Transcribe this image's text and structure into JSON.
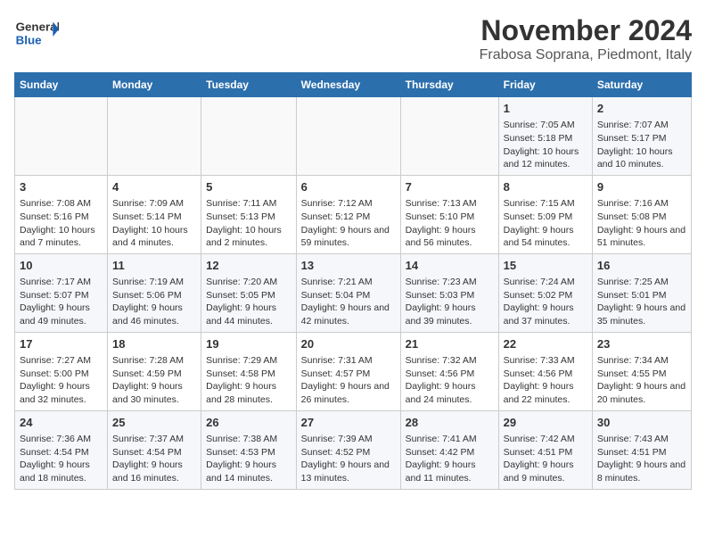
{
  "header": {
    "logo_general": "General",
    "logo_blue": "Blue",
    "month_year": "November 2024",
    "location": "Frabosa Soprana, Piedmont, Italy"
  },
  "calendar": {
    "day_headers": [
      "Sunday",
      "Monday",
      "Tuesday",
      "Wednesday",
      "Thursday",
      "Friday",
      "Saturday"
    ],
    "weeks": [
      [
        {
          "day": "",
          "info": ""
        },
        {
          "day": "",
          "info": ""
        },
        {
          "day": "",
          "info": ""
        },
        {
          "day": "",
          "info": ""
        },
        {
          "day": "",
          "info": ""
        },
        {
          "day": "1",
          "info": "Sunrise: 7:05 AM\nSunset: 5:18 PM\nDaylight: 10 hours and 12 minutes."
        },
        {
          "day": "2",
          "info": "Sunrise: 7:07 AM\nSunset: 5:17 PM\nDaylight: 10 hours and 10 minutes."
        }
      ],
      [
        {
          "day": "3",
          "info": "Sunrise: 7:08 AM\nSunset: 5:16 PM\nDaylight: 10 hours and 7 minutes."
        },
        {
          "day": "4",
          "info": "Sunrise: 7:09 AM\nSunset: 5:14 PM\nDaylight: 10 hours and 4 minutes."
        },
        {
          "day": "5",
          "info": "Sunrise: 7:11 AM\nSunset: 5:13 PM\nDaylight: 10 hours and 2 minutes."
        },
        {
          "day": "6",
          "info": "Sunrise: 7:12 AM\nSunset: 5:12 PM\nDaylight: 9 hours and 59 minutes."
        },
        {
          "day": "7",
          "info": "Sunrise: 7:13 AM\nSunset: 5:10 PM\nDaylight: 9 hours and 56 minutes."
        },
        {
          "day": "8",
          "info": "Sunrise: 7:15 AM\nSunset: 5:09 PM\nDaylight: 9 hours and 54 minutes."
        },
        {
          "day": "9",
          "info": "Sunrise: 7:16 AM\nSunset: 5:08 PM\nDaylight: 9 hours and 51 minutes."
        }
      ],
      [
        {
          "day": "10",
          "info": "Sunrise: 7:17 AM\nSunset: 5:07 PM\nDaylight: 9 hours and 49 minutes."
        },
        {
          "day": "11",
          "info": "Sunrise: 7:19 AM\nSunset: 5:06 PM\nDaylight: 9 hours and 46 minutes."
        },
        {
          "day": "12",
          "info": "Sunrise: 7:20 AM\nSunset: 5:05 PM\nDaylight: 9 hours and 44 minutes."
        },
        {
          "day": "13",
          "info": "Sunrise: 7:21 AM\nSunset: 5:04 PM\nDaylight: 9 hours and 42 minutes."
        },
        {
          "day": "14",
          "info": "Sunrise: 7:23 AM\nSunset: 5:03 PM\nDaylight: 9 hours and 39 minutes."
        },
        {
          "day": "15",
          "info": "Sunrise: 7:24 AM\nSunset: 5:02 PM\nDaylight: 9 hours and 37 minutes."
        },
        {
          "day": "16",
          "info": "Sunrise: 7:25 AM\nSunset: 5:01 PM\nDaylight: 9 hours and 35 minutes."
        }
      ],
      [
        {
          "day": "17",
          "info": "Sunrise: 7:27 AM\nSunset: 5:00 PM\nDaylight: 9 hours and 32 minutes."
        },
        {
          "day": "18",
          "info": "Sunrise: 7:28 AM\nSunset: 4:59 PM\nDaylight: 9 hours and 30 minutes."
        },
        {
          "day": "19",
          "info": "Sunrise: 7:29 AM\nSunset: 4:58 PM\nDaylight: 9 hours and 28 minutes."
        },
        {
          "day": "20",
          "info": "Sunrise: 7:31 AM\nSunset: 4:57 PM\nDaylight: 9 hours and 26 minutes."
        },
        {
          "day": "21",
          "info": "Sunrise: 7:32 AM\nSunset: 4:56 PM\nDaylight: 9 hours and 24 minutes."
        },
        {
          "day": "22",
          "info": "Sunrise: 7:33 AM\nSunset: 4:56 PM\nDaylight: 9 hours and 22 minutes."
        },
        {
          "day": "23",
          "info": "Sunrise: 7:34 AM\nSunset: 4:55 PM\nDaylight: 9 hours and 20 minutes."
        }
      ],
      [
        {
          "day": "24",
          "info": "Sunrise: 7:36 AM\nSunset: 4:54 PM\nDaylight: 9 hours and 18 minutes."
        },
        {
          "day": "25",
          "info": "Sunrise: 7:37 AM\nSunset: 4:54 PM\nDaylight: 9 hours and 16 minutes."
        },
        {
          "day": "26",
          "info": "Sunrise: 7:38 AM\nSunset: 4:53 PM\nDaylight: 9 hours and 14 minutes."
        },
        {
          "day": "27",
          "info": "Sunrise: 7:39 AM\nSunset: 4:52 PM\nDaylight: 9 hours and 13 minutes."
        },
        {
          "day": "28",
          "info": "Sunrise: 7:41 AM\nSunset: 4:42 PM\nDaylight: 9 hours and 11 minutes."
        },
        {
          "day": "29",
          "info": "Sunrise: 7:42 AM\nSunset: 4:51 PM\nDaylight: 9 hours and 9 minutes."
        },
        {
          "day": "30",
          "info": "Sunrise: 7:43 AM\nSunset: 4:51 PM\nDaylight: 9 hours and 8 minutes."
        }
      ]
    ]
  }
}
